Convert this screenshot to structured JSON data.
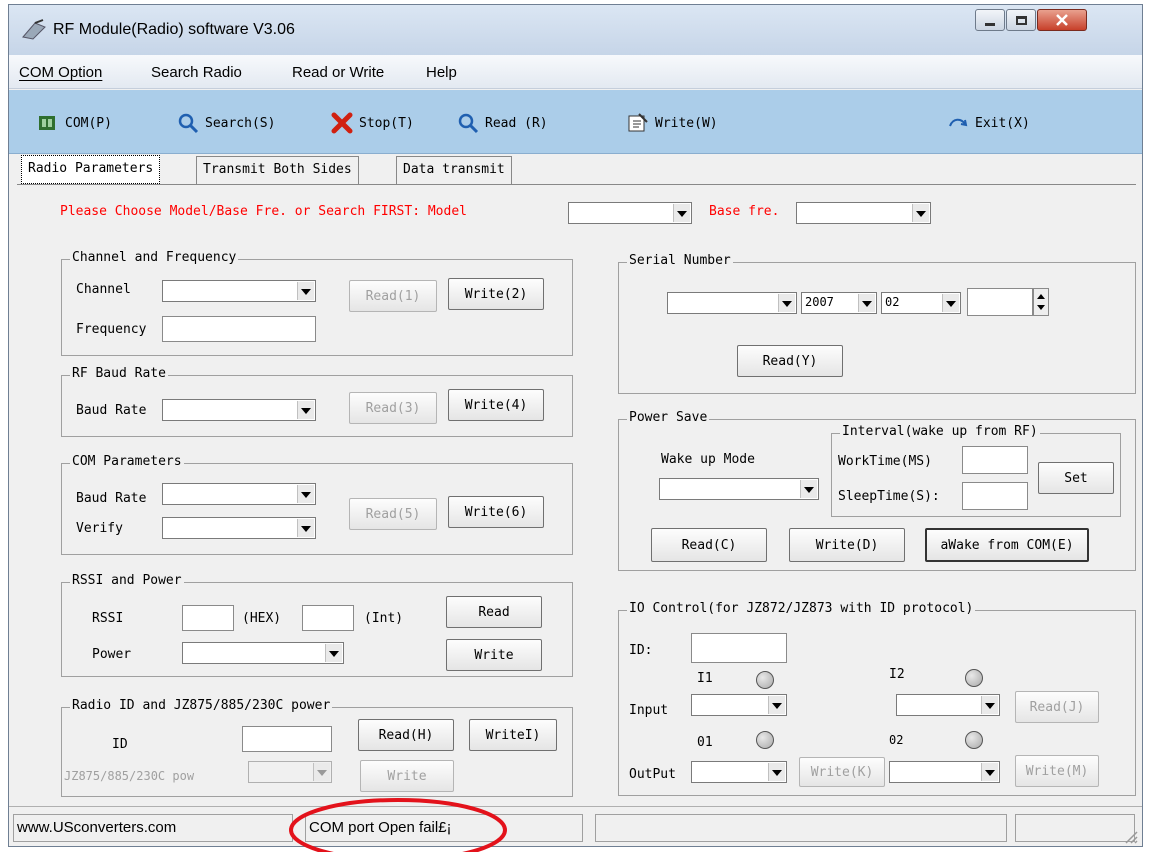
{
  "window": {
    "title": "RF Module(Radio) software  V3.06"
  },
  "menu": [
    "COM Option",
    "Search Radio",
    "Read or Write",
    "Help"
  ],
  "toolbar": {
    "com": "COM(P)",
    "search": "Search(S)",
    "stop": "Stop(T)",
    "read": "Read (R)",
    "write": "Write(W)",
    "exit": "Exit(X)"
  },
  "tabs": [
    "Radio Parameters",
    "Transmit Both Sides",
    "Data transmit"
  ],
  "prompt": {
    "text": "Please Choose Model/Base Fre. or Search FIRST: Model",
    "base_label": "Base fre.",
    "color": "#ff0000"
  },
  "channel": {
    "title": "Channel and Frequency",
    "channel_label": "Channel",
    "frequency_label": "Frequency",
    "read": "Read(1)",
    "write": "Write(2)"
  },
  "rfbaud": {
    "title": "RF Baud Rate",
    "label": "Baud Rate",
    "read": "Read(3)",
    "write": "Write(4)"
  },
  "com": {
    "title": "COM Parameters",
    "baud_label": "Baud Rate",
    "verify_label": "Verify",
    "read": "Read(5)",
    "write": "Write(6)"
  },
  "rssi": {
    "title": "RSSI and Power",
    "rssi_label": "RSSI",
    "hex_label": "(HEX)",
    "int_label": "(Int)",
    "power_label": "Power",
    "read": "Read",
    "write": "Write"
  },
  "radioid": {
    "title": "Radio ID and JZ875/885/230C power",
    "id_label": "ID",
    "read": "Read(H)",
    "write": "WriteI)",
    "pow_label": "JZ875/885/230C pow",
    "write2": "Write"
  },
  "serial": {
    "title": "Serial Number",
    "year": "2007",
    "month": "02",
    "read": "Read(Y)"
  },
  "power": {
    "title": "Power Save",
    "wake_label": "Wake up Mode",
    "interval_title": "Interval(wake up from RF)",
    "work_label": "WorkTime(MS)",
    "sleep_label": "SleepTime(S):",
    "set": "Set",
    "read": "Read(C)",
    "write": "Write(D)",
    "wake": "aWake from COM(E)"
  },
  "io": {
    "title": "IO Control(for JZ872/JZ873 with ID protocol)",
    "id_label": "ID:",
    "i1": "I1",
    "i2": "I2",
    "input_label": "Input",
    "o1": "01",
    "o2": "02",
    "output_label": "OutPut",
    "read": "Read(J)",
    "write_k": "Write(K)",
    "write_m": "Write(M)"
  },
  "status": {
    "site": "www.USconverters.com",
    "message": "COM port Open fail£¡"
  }
}
